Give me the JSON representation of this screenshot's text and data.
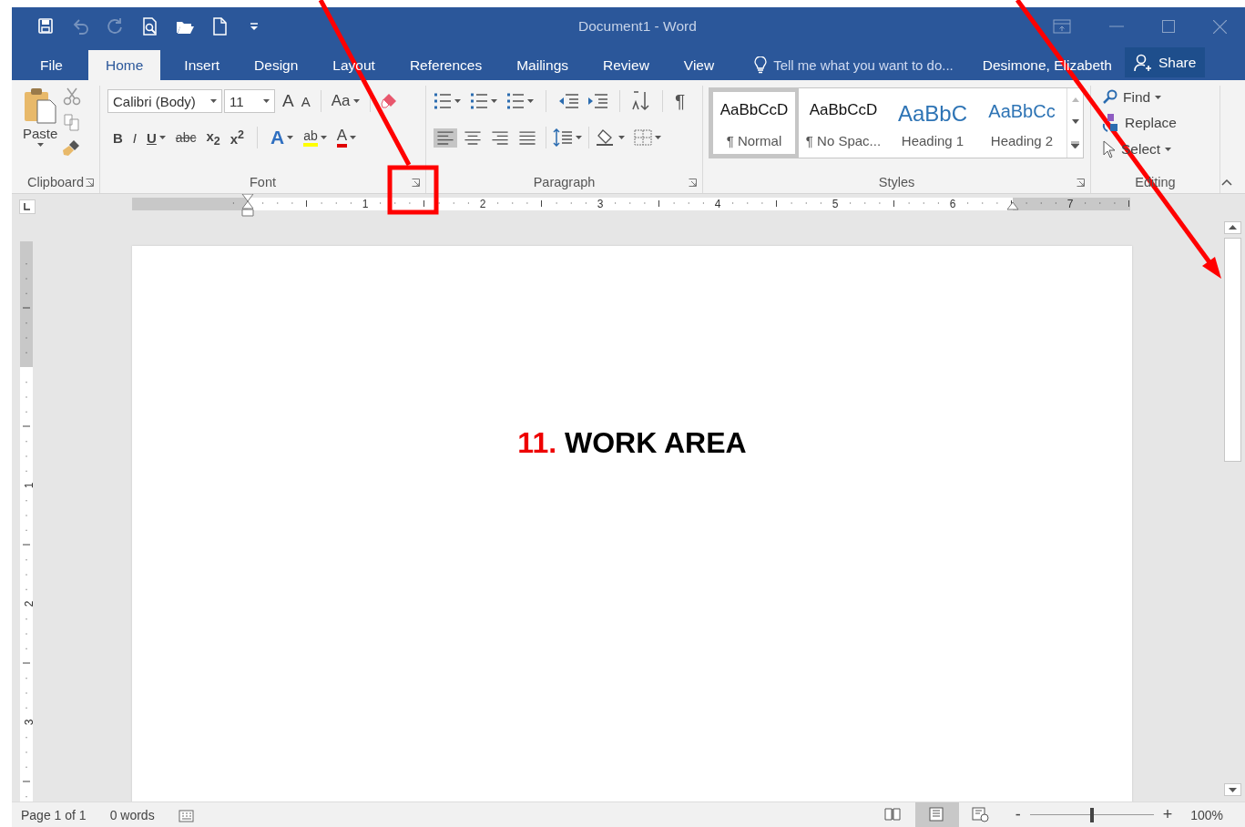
{
  "quick_access": [
    {
      "kind": "save",
      "disabled": false
    },
    {
      "kind": "undo",
      "disabled": true
    },
    {
      "kind": "redo",
      "disabled": true
    },
    {
      "kind": "preview",
      "disabled": false
    },
    {
      "kind": "open",
      "disabled": false
    },
    {
      "kind": "new",
      "disabled": false
    },
    {
      "kind": "customize",
      "disabled": false
    }
  ],
  "window": {
    "title": "Document1 - Word"
  },
  "tabs": [
    {
      "label": "File",
      "selected": false
    },
    {
      "label": "Home",
      "selected": true
    },
    {
      "label": "Insert",
      "selected": false
    },
    {
      "label": "Design",
      "selected": false
    },
    {
      "label": "Layout",
      "selected": false
    },
    {
      "label": "References",
      "selected": false
    },
    {
      "label": "Mailings",
      "selected": false
    },
    {
      "label": "Review",
      "selected": false
    },
    {
      "label": "View",
      "selected": false
    }
  ],
  "tell_me": {
    "placeholder": "Tell me what you want to do..."
  },
  "user": "Desimone, Elizabeth",
  "share": "Share",
  "clipboard": {
    "paste": "Paste",
    "label": "Clipboard"
  },
  "font": {
    "name": "Calibri (Body)",
    "size": "11",
    "grow": "A",
    "shrink": "A",
    "change_case": "Aa",
    "format_buttons": [
      {
        "kind": "bold",
        "text": "B"
      },
      {
        "kind": "italic",
        "text": "I"
      },
      {
        "kind": "underline",
        "text": "U"
      },
      {
        "kind": "strike",
        "text": "abc"
      },
      {
        "kind": "sub",
        "text": "x$_{2}$"
      },
      {
        "kind": "sup",
        "text": "x$^{2}$"
      }
    ],
    "text_effects": "A",
    "highlight": "ab",
    "font_color": "A",
    "label": "Font"
  },
  "paragraph": {
    "pilcrow": "¶",
    "alignments": [
      {
        "kind": "left",
        "selected": true
      },
      {
        "kind": "center",
        "selected": false
      },
      {
        "kind": "right",
        "selected": false
      },
      {
        "kind": "justify",
        "selected": false
      }
    ],
    "label": "Paragraph"
  },
  "styles": {
    "items": [
      {
        "kind": "normal",
        "preview": "AaBbCcD",
        "name": "¶ Normal",
        "selected": true
      },
      {
        "kind": "normal",
        "preview": "AaBbCcD",
        "name": "¶ No Spac...",
        "selected": false
      },
      {
        "kind": "heading1",
        "preview": "AaBbC",
        "name": "Heading 1",
        "selected": false
      },
      {
        "kind": "heading2",
        "preview": "AaBbCc",
        "name": "Heading 2",
        "selected": false
      }
    ],
    "label": "Styles"
  },
  "editing": {
    "items": [
      {
        "kind": "find",
        "text": "Find"
      },
      {
        "kind": "replace",
        "text": "Replace"
      },
      {
        "kind": "select",
        "text": "Select"
      }
    ],
    "label": "Editing"
  },
  "ruler": {
    "numbers": [
      "1",
      "2",
      "3",
      "4",
      "5",
      "6",
      "7"
    ]
  },
  "vertical_ruler": {
    "numbers": [
      "1",
      "2",
      "3"
    ]
  },
  "document": {
    "annotation": {
      "number": "11.",
      "label": "WORK AREA"
    }
  },
  "status_bar": {
    "page": "Page 1 of 1",
    "words": "0 words",
    "views": [
      {
        "kind": "read",
        "selected": false
      },
      {
        "kind": "print",
        "selected": true
      },
      {
        "kind": "web",
        "selected": false
      }
    ],
    "zoom_out": "-",
    "zoom_in": "+",
    "zoom": {
      "level": 0.5
    },
    "zoom_text": "100%"
  }
}
